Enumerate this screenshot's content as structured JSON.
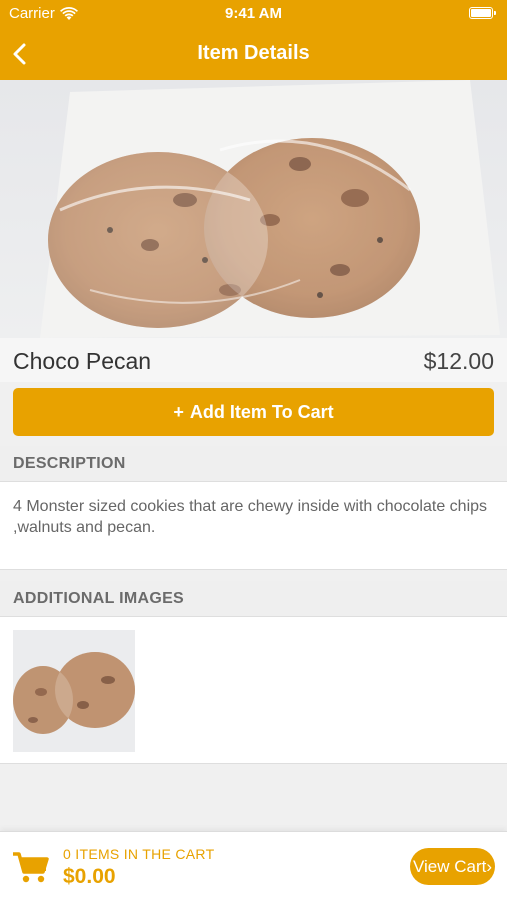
{
  "status_bar": {
    "carrier": "Carrier",
    "time": "9:41 AM"
  },
  "nav": {
    "title": "Item Details"
  },
  "product": {
    "name": "Choco Pecan",
    "price": "$12.00"
  },
  "add_to_cart": {
    "plus": "+",
    "label": "Add Item To Cart"
  },
  "description": {
    "header": "DESCRIPTION",
    "text": "4 Monster sized cookies that are chewy inside with chocolate chips ,walnuts and pecan."
  },
  "additional_images": {
    "header": "ADDITIONAL IMAGES"
  },
  "cart_bar": {
    "items_label": "0 ITEMS IN THE CART",
    "total": "$0.00",
    "view_cart_label": "View Cart",
    "chevron": "›"
  },
  "colors": {
    "accent": "#e8a200",
    "background": "#f0f0f0"
  },
  "icons": [
    "wifi-icon",
    "battery-icon",
    "back-chevron-icon",
    "cart-icon"
  ]
}
